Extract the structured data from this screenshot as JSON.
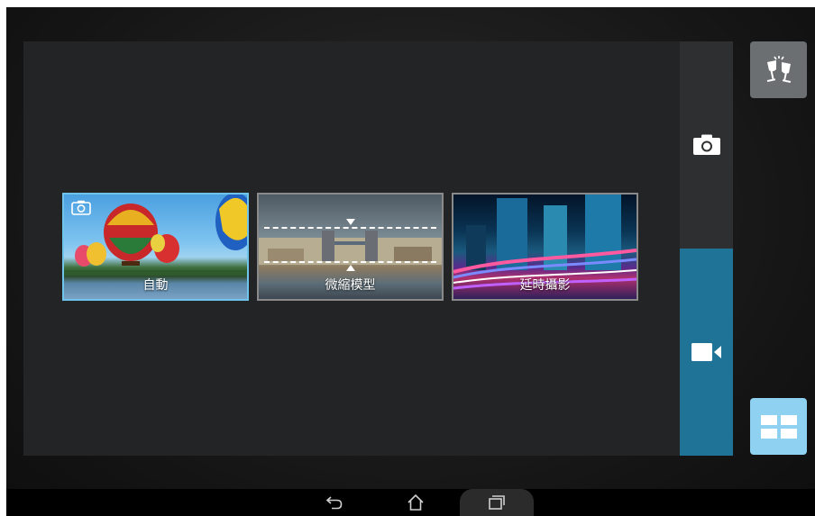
{
  "modes": [
    {
      "label": "自動",
      "selected": true
    },
    {
      "label": "微縮模型",
      "selected": false
    },
    {
      "label": "延時攝影",
      "selected": false
    }
  ],
  "rail": {
    "photo_icon": "camera-icon",
    "video_icon": "video-camera-icon",
    "active": "video"
  },
  "buttons": {
    "party_icon": "toast-glasses-icon",
    "grid_icon": "grid-icon"
  },
  "nav": {
    "back_icon": "back-icon",
    "home_icon": "home-icon",
    "recent_icon": "recent-apps-icon"
  },
  "colors": {
    "accent": "#1f7397",
    "selected_border": "#6ec4ea",
    "grid_button": "#8fd1f0"
  }
}
